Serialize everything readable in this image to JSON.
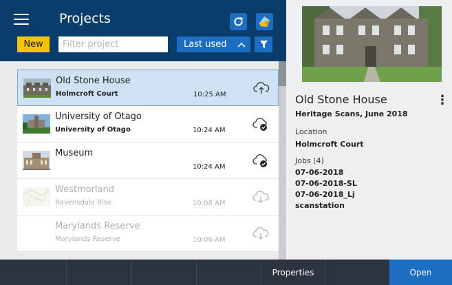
{
  "header": {
    "title": "Projects",
    "new_label": "New",
    "filter_placeholder": "Filter project",
    "sort_label": "Last used",
    "sort_direction_icon": "chevron-up-icon",
    "refresh_icon": "refresh-icon",
    "app_logo_icon": "app-logo-icon",
    "filter_icon": "funnel-icon"
  },
  "projects": [
    {
      "name": "Old Stone House",
      "location": "Holmcroft Court",
      "time": "10:25 AM",
      "status_icon": "cloud-upload-icon",
      "selected": true,
      "muted": false
    },
    {
      "name": "University of Otago",
      "location": "University of Otago",
      "time": "10:24 AM",
      "status_icon": "cloud-synced-icon",
      "selected": false,
      "muted": false
    },
    {
      "name": "Museum",
      "location": "",
      "time": "10:24 AM",
      "status_icon": "cloud-synced-icon",
      "selected": false,
      "muted": false
    },
    {
      "name": "Westmorland",
      "location": "Ravensdale Rise",
      "time": "10:08 AM",
      "status_icon": "cloud-download-icon",
      "selected": false,
      "muted": true
    },
    {
      "name": "Marylands Reserve",
      "location": "Marylands Reserve",
      "time": "10:06 AM",
      "status_icon": "cloud-download-icon",
      "selected": false,
      "muted": true
    }
  ],
  "details": {
    "title": "Old Stone House",
    "subtitle": "Heritage Scans, June 2018",
    "location_label": "Location",
    "location": "Holmcroft Court",
    "jobs_label": "Jobs (4)",
    "jobs": [
      "07-06-2018",
      "07-06-2018-SL",
      "07-06-2018_Lj",
      "scanstation"
    ],
    "more_icon": "more-vertical-icon"
  },
  "toolbar": {
    "properties_label": "Properties",
    "open_label": "Open"
  },
  "colors": {
    "header_bg": "#0b3d6b",
    "accent_blue": "#1b6ec2",
    "new_button": "#f5c400",
    "selected_row": "#cfe2f3",
    "bottom_bar": "#2c3440"
  }
}
